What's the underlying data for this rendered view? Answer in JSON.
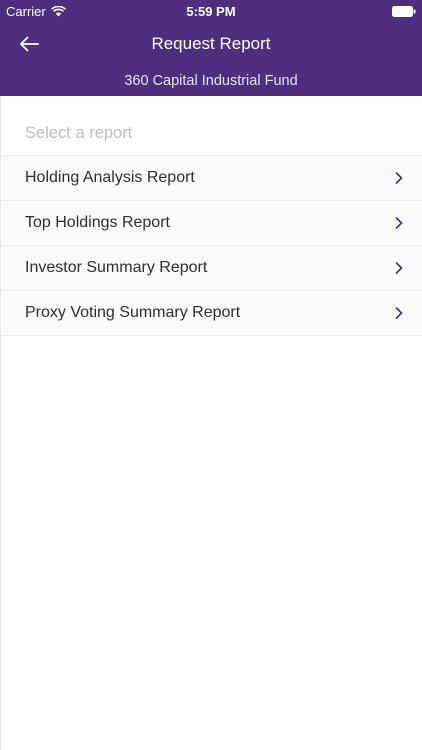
{
  "status_bar": {
    "carrier": "Carrier",
    "time": "5:59 PM"
  },
  "nav": {
    "title": "Request Report",
    "subtitle": "360 Capital Industrial Fund"
  },
  "list": {
    "placeholder": "Select a report",
    "items": [
      {
        "label": "Holding Analysis Report"
      },
      {
        "label": "Top Holdings Report"
      },
      {
        "label": "Investor Summary Report"
      },
      {
        "label": "Proxy Voting Summary Report"
      }
    ]
  },
  "colors": {
    "header_bg": "#4f2d7f",
    "chevron": "#4f2d7f"
  }
}
